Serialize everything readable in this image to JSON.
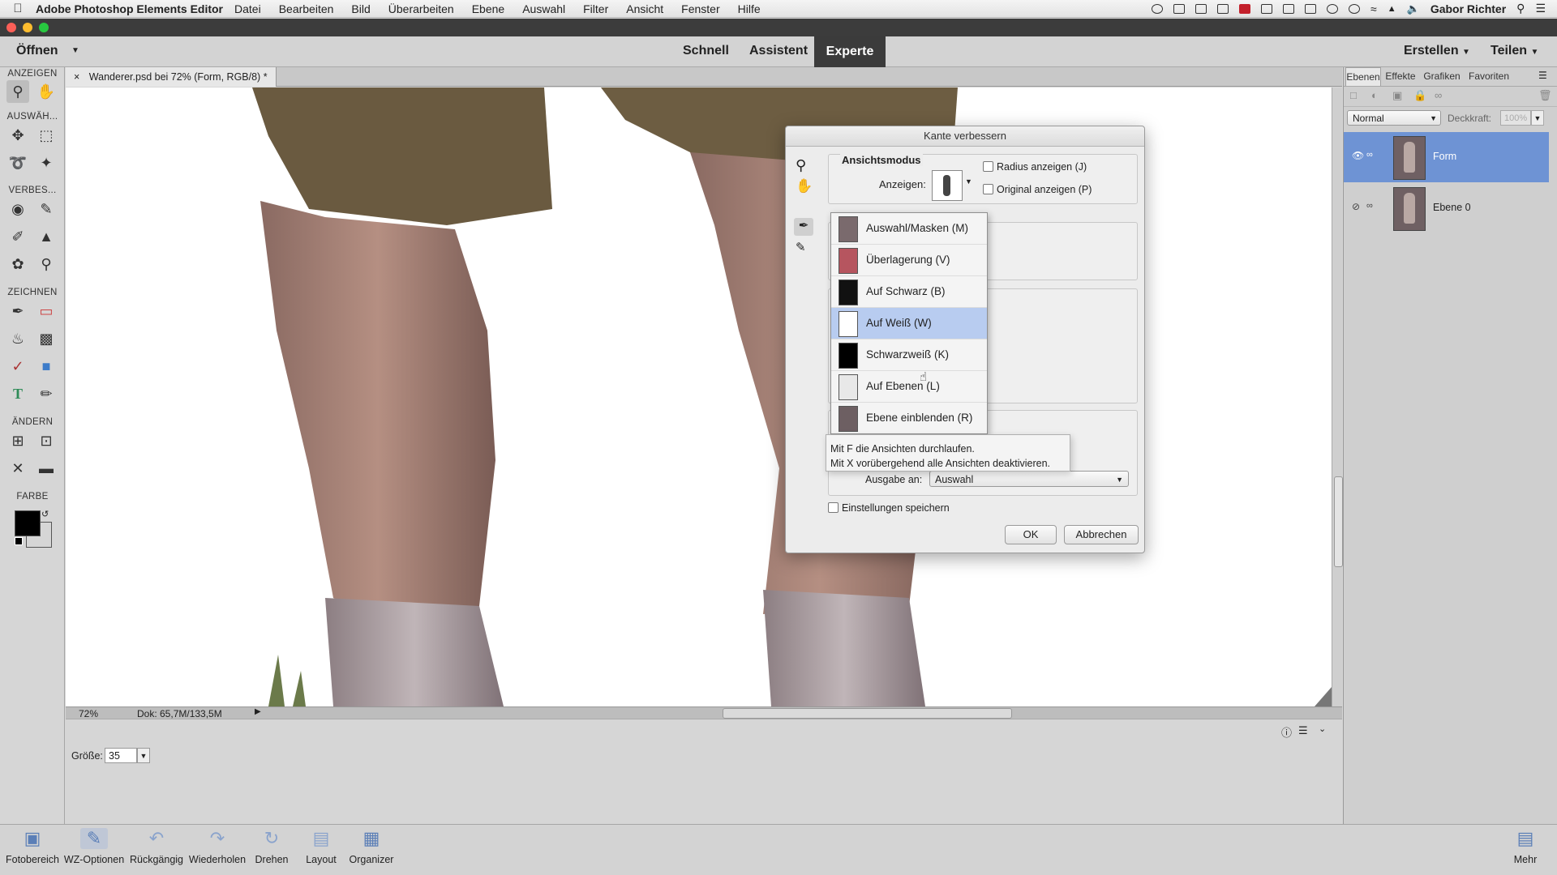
{
  "menubar": {
    "app_name": "Adobe Photoshop Elements Editor",
    "items": [
      "Datei",
      "Bearbeiten",
      "Bild",
      "Überarbeiten",
      "Ebene",
      "Auswahl",
      "Filter",
      "Ansicht",
      "Fenster",
      "Hilfe"
    ],
    "user": "Gabor Richter"
  },
  "appbar": {
    "open_label": "Öffnen",
    "modes": {
      "quick": "Schnell",
      "guided": "Assistent",
      "expert": "Experte"
    },
    "create_label": "Erstellen",
    "share_label": "Teilen"
  },
  "toolbox": {
    "sections": {
      "view": "ANZEIGEN",
      "select": "AUSWÄH...",
      "enhance": "VERBES...",
      "draw": "ZEICHNEN",
      "modify": "ÄNDERN",
      "color": "FARBE"
    },
    "colors": {
      "foreground": "#000000",
      "background": "#ffffff"
    }
  },
  "document": {
    "tab_title": "Wanderer.psd bei 72% (Form, RGB/8) *",
    "close_glyph": "×",
    "zoom": "72%",
    "doc_size": "Dok: 65,7M/133,5M"
  },
  "tool_options": {
    "size_label": "Größe:",
    "size_value": "35"
  },
  "layers_panel": {
    "tabs": [
      "Ebenen",
      "Effekte",
      "Grafiken",
      "Favoriten"
    ],
    "blend_mode": "Normal",
    "opacity_label": "Deckkraft:",
    "opacity_value": "100%",
    "layers": [
      {
        "name": "Form",
        "selected": true
      },
      {
        "name": "Ebene 0",
        "selected": false
      }
    ]
  },
  "dialog": {
    "title": "Kante verbessern",
    "view_mode_heading": "Ansichtsmodus",
    "show_label": "Anzeigen:",
    "show_radius": "Radius anzeigen (J)",
    "show_original": "Original anzeigen (P)",
    "output_label": "Ausgabe an:",
    "output_value": "Auswahl",
    "save_settings": "Einstellungen speichern",
    "ok_label": "OK",
    "cancel_label": "Abbrechen"
  },
  "view_menu": {
    "items": [
      {
        "label": "Auswahl/Masken (M)",
        "selected": false
      },
      {
        "label": "Überlagerung (V)",
        "selected": false
      },
      {
        "label": "Auf Schwarz (B)",
        "selected": false
      },
      {
        "label": "Auf Weiß (W)",
        "selected": true
      },
      {
        "label": "Schwarzweiß (K)",
        "selected": false
      },
      {
        "label": "Auf Ebenen (L)",
        "selected": false
      },
      {
        "label": "Ebene einblenden (R)",
        "selected": false
      }
    ],
    "hint_line1": "Mit F die Ansichten durchlaufen.",
    "hint_line2": "Mit X vorübergehend alle Ansichten deaktivieren."
  },
  "bottombar": {
    "items": [
      "Fotobereich",
      "WZ-Optionen",
      "Rückgängig",
      "Wiederholen",
      "Drehen",
      "Layout",
      "Organizer"
    ],
    "more_label": "Mehr"
  },
  "colors": {
    "accent_selected_layer": "#6e93d4",
    "menu_highlight": "#b8ccf0",
    "titlebar": "#3c3c3c"
  }
}
